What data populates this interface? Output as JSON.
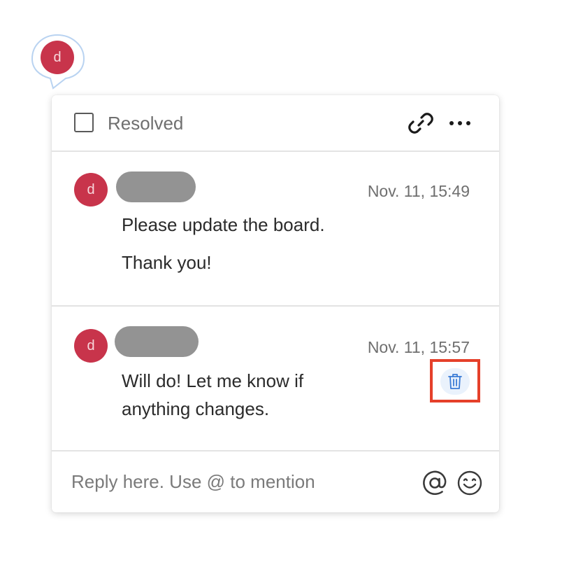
{
  "pin": {
    "avatar_initial": "d"
  },
  "header": {
    "resolved_label": "Resolved",
    "resolved_checked": false
  },
  "comments": [
    {
      "avatar_initial": "d",
      "timestamp": "Nov. 11, 15:49",
      "paragraphs": [
        "Please update the board.",
        "Thank you!"
      ]
    },
    {
      "avatar_initial": "d",
      "timestamp": "Nov. 11, 15:57",
      "paragraphs": [
        "Will do! Let me know if anything changes."
      ]
    }
  ],
  "reply": {
    "placeholder": "Reply here. Use @ to mention"
  },
  "icons": {
    "link": "link-icon",
    "more": "more-horizontal-icon",
    "delete": "trash-icon",
    "mention": "at-sign-icon",
    "emoji": "smiley-icon"
  },
  "colors": {
    "avatar": "#c8344b",
    "highlight_border": "#e5402a",
    "delete_icon": "#3a7bd5"
  }
}
